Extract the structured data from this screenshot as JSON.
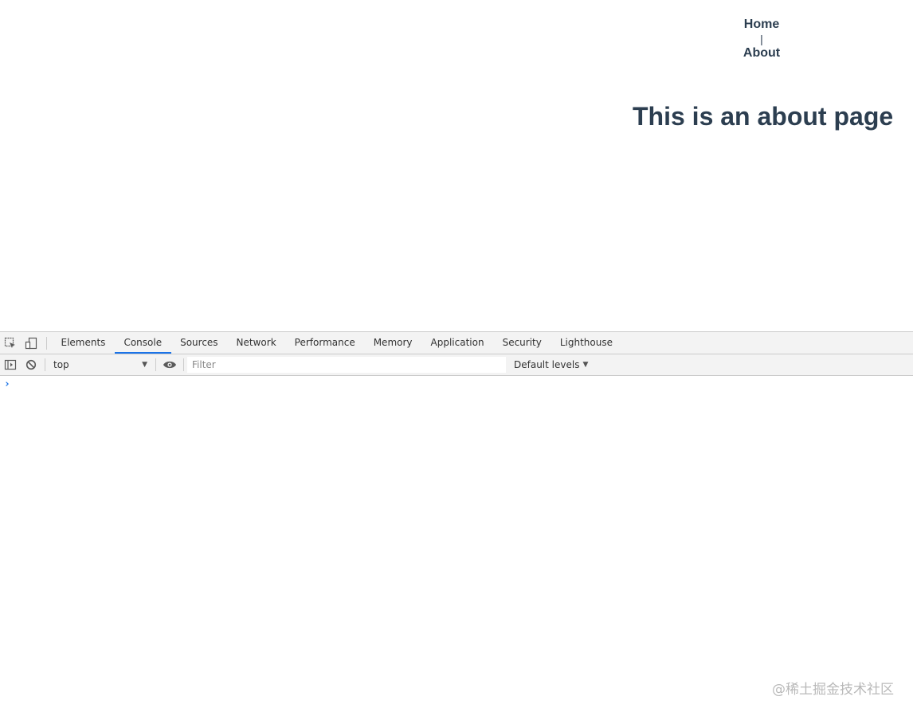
{
  "page": {
    "nav": {
      "home_label": "Home",
      "separator": "|",
      "about_label": "About"
    },
    "title": "This is an about page",
    "text_color": "#2c3e50"
  },
  "devtools": {
    "tabs": [
      {
        "label": "Elements"
      },
      {
        "label": "Console",
        "active": true
      },
      {
        "label": "Sources"
      },
      {
        "label": "Network"
      },
      {
        "label": "Performance"
      },
      {
        "label": "Memory"
      },
      {
        "label": "Application"
      },
      {
        "label": "Security"
      },
      {
        "label": "Lighthouse"
      }
    ],
    "toolbar": {
      "context_value": "top",
      "filter_placeholder": "Filter",
      "levels_label": "Default levels"
    },
    "console": {
      "prompt": "›"
    },
    "accent_color": "#1a73e8",
    "icons": [
      "inspect-element-icon",
      "device-toolbar-icon",
      "sidebar-toggle-icon",
      "clear-console-icon",
      "eye-icon"
    ]
  },
  "watermark": "@稀土掘金技术社区"
}
